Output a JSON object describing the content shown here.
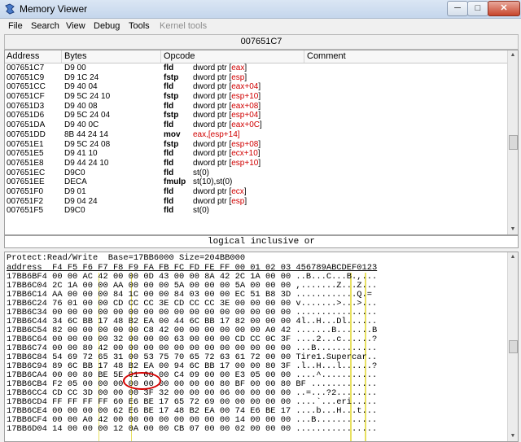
{
  "window": {
    "title": "Memory Viewer",
    "min_label": "─",
    "max_label": "□",
    "close_label": "✕"
  },
  "menu": {
    "file": "File",
    "search": "Search",
    "view": "View",
    "debug": "Debug",
    "tools": "Tools",
    "kernel_tools": "Kernel tools"
  },
  "address_bar": "007651C7",
  "disasm": {
    "headers": {
      "address": "Address",
      "bytes": "Bytes",
      "opcode": "Opcode",
      "comment": "Comment"
    },
    "rows": [
      {
        "addr": "007651C7",
        "bytes": "D9 00",
        "mn": "fld",
        "pre": "dword ptr [",
        "reg": "eax",
        "post": "]"
      },
      {
        "addr": "007651C9",
        "bytes": "D9 1C 24",
        "mn": "fstp",
        "pre": "dword ptr [",
        "reg": "esp",
        "post": "]"
      },
      {
        "addr": "007651CC",
        "bytes": "D9 40 04",
        "mn": "fld",
        "pre": "dword ptr [",
        "reg": "eax+04",
        "post": "]"
      },
      {
        "addr": "007651CF",
        "bytes": "D9 5C 24 10",
        "mn": "fstp",
        "pre": "dword ptr [",
        "reg": "esp+10",
        "post": "]"
      },
      {
        "addr": "007651D3",
        "bytes": "D9 40 08",
        "mn": "fld",
        "pre": "dword ptr [",
        "reg": "eax+08",
        "post": "]"
      },
      {
        "addr": "007651D6",
        "bytes": "D9 5C 24 04",
        "mn": "fstp",
        "pre": "dword ptr [",
        "reg": "esp+04",
        "post": "]"
      },
      {
        "addr": "007651DA",
        "bytes": "D9 40 0C",
        "mn": "fld",
        "pre": "dword ptr [",
        "reg": "eax+0C",
        "post": "]"
      },
      {
        "addr": "007651DD",
        "bytes": "8B 44 24 14",
        "mn": "mov",
        "pre": "",
        "reg": "eax,[esp+14]",
        "post": ""
      },
      {
        "addr": "007651E1",
        "bytes": "D9 5C 24 08",
        "mn": "fstp",
        "pre": "dword ptr [",
        "reg": "esp+08",
        "post": "]"
      },
      {
        "addr": "007651E5",
        "bytes": "D9 41 10",
        "mn": "fld",
        "pre": "dword ptr [",
        "reg": "ecx+10",
        "post": "]"
      },
      {
        "addr": "007651E8",
        "bytes": "D9 44 24 10",
        "mn": "fld",
        "pre": "dword ptr [",
        "reg": "esp+10",
        "post": "]"
      },
      {
        "addr": "007651EC",
        "bytes": "D9C0",
        "mn": "fld",
        "pre": "st(0)",
        "reg": "",
        "post": ""
      },
      {
        "addr": "007651EE",
        "bytes": "DECA",
        "mn": "fmulp",
        "pre": "st(10),st(0)",
        "reg": "",
        "post": ""
      },
      {
        "addr": "007651F0",
        "bytes": "D9 01",
        "mn": "fld",
        "pre": "dword ptr [",
        "reg": "ecx",
        "post": "]"
      },
      {
        "addr": "007651F2",
        "bytes": "D9 04 24",
        "mn": "fld",
        "pre": "dword ptr [",
        "reg": "esp",
        "post": "]"
      },
      {
        "addr": "007651F5",
        "bytes": "D9C0",
        "mn": "fld",
        "pre": "st(0)",
        "reg": "",
        "post": ""
      }
    ]
  },
  "instruction_description": "logical inclusive or",
  "hex": {
    "protect_line": "Protect:Read/Write  Base=17BB6000 Size=204BB000",
    "header": "address  F4 F5 F6 F7 F8 F9 FA FB FC FD FE FF 00 01 02 03 456789ABCDEF0123",
    "rows": [
      "17BB6BF4 00 00 AC 42 00 00 0D 43 00 00 8A 42 2C 1A 00 00 ..B...C...B.,...",
      "17BB6C04 2C 1A 00 00 AA 00 00 00 5A 00 00 00 5A 00 00 00 ,.......Z...Z...",
      "17BB6C14 AA 00 00 00 84 1C 00 00 84 03 00 00 EC 51 B8 3D ............Q.=",
      "17BB6C24 76 01 00 00 CD CC CC 3E CD CC CC 3E 00 00 00 00 v.......>...>...",
      "17BB6C34 00 00 00 00 00 00 00 00 00 00 00 00 00 00 00 00 ................",
      "17BB6C44 34 6C BB 17 48 B2 EA 00 44 6C BB 17 82 00 00 00 4l..H...Dl......",
      "17BB6C54 82 00 00 00 00 00 C8 42 00 00 00 00 00 00 A0 42 .......B.......B",
      "17BB6C64 00 00 00 00 32 00 00 00 63 00 00 00 CD CC 0C 3F ....2...c......?",
      "17BB6C74 00 00 80 42 00 00 00 00 00 00 00 00 00 00 00 00 ...B............",
      "17BB6C84 54 69 72 65 31 00 53 75 70 65 72 63 61 72 00 00 Tire1.Supercar..",
      "17BB6C94 89 6C BB 17 48 B2 EA 00 94 6C BB 17 00 00 80 3F .l..H...l......?",
      "17BB6CA4 00 00 80 BE 5E 01 00 00 C4 09 00 00 E3 05 00 00 ....^...........",
      "17BB6CB4 F2 05 00 00 00 00 00 00 00 00 00 80 BF 00 00 80 BF .............",
      "17BB6CC4 CD CC 3D 00 00 00 3F 32 00 00 00 06 00 00 00 00 ..=...?2........",
      "17BB6CD4 FF FF FF FF 60 E6 BE 17 65 72 69 00 00 00 00 00 ....`...eri.....",
      "17BB6CE4 00 00 00 00 62 E6 BE 17 48 B2 EA 00 74 E6 BE 17 ....b...H...t...",
      "17BB6CF4 00 00 A0 42 00 00 00 00 00 00 00 00 14 00 00 00 ...B............",
      "17BB6D04 14 00 00 00 12 0A 00 00 CB 07 00 00 02 00 00 00 ................"
    ]
  }
}
